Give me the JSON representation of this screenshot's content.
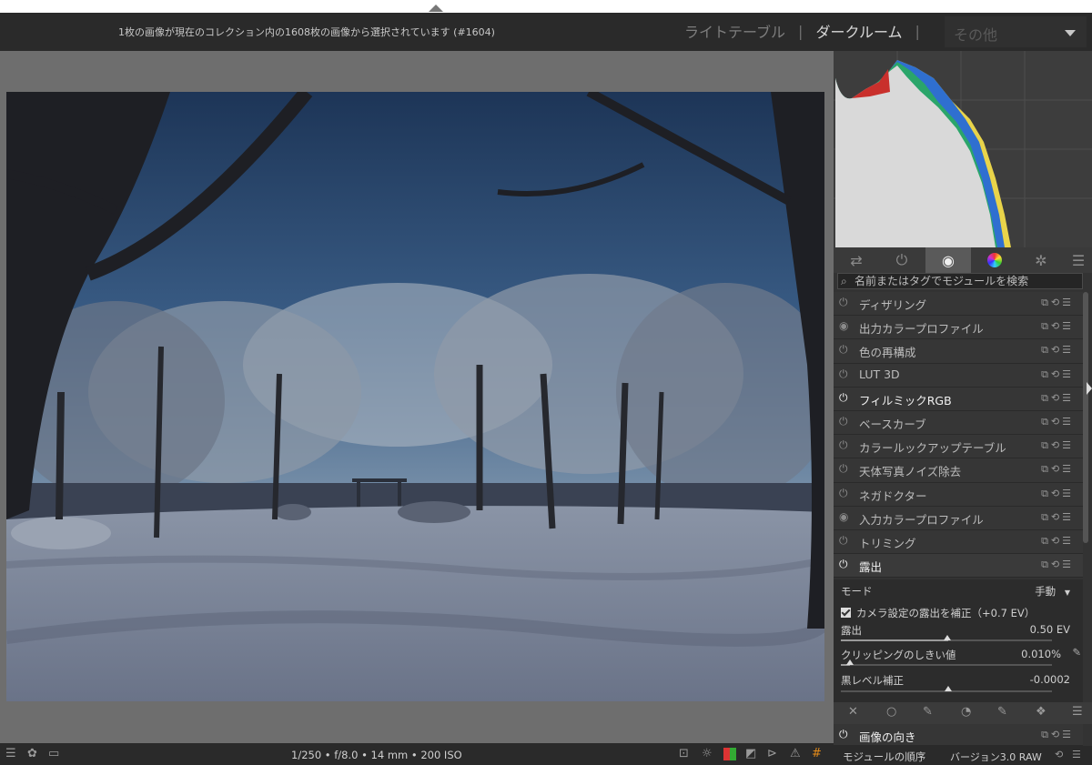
{
  "header": {
    "status": "1枚の画像が現在のコレクション内の1608枚の画像から選択されています (#1604)",
    "views": [
      "ライトテーブル",
      "ダークルーム"
    ],
    "separator": "|",
    "more_label": "その他"
  },
  "panel": {
    "search_placeholder": "名前またはタグでモジュールを検索",
    "modules": [
      {
        "label": "ディザリング",
        "state": "off"
      },
      {
        "label": "出力カラープロファイル",
        "state": "always"
      },
      {
        "label": "色の再構成",
        "state": "off"
      },
      {
        "label": "LUT 3D",
        "state": "off"
      },
      {
        "label": "フィルミックRGB",
        "state": "on"
      },
      {
        "label": "ベースカーブ",
        "state": "off"
      },
      {
        "label": "カラールックアップテーブル",
        "state": "off"
      },
      {
        "label": "天体写真ノイズ除去",
        "state": "off"
      },
      {
        "label": "ネガドクター",
        "state": "off"
      },
      {
        "label": "入力カラープロファイル",
        "state": "always"
      },
      {
        "label": "トリミング",
        "state": "off"
      },
      {
        "label": "露出",
        "state": "on"
      }
    ],
    "exposure": {
      "mode_label": "モード",
      "mode_value": "手動",
      "compensate_label": "カメラ設定の露出を補正（+0.7 EV）",
      "exposure_label": "露出",
      "exposure_value": "0.50 EV",
      "clipping_label": "クリッピングのしきい値",
      "clipping_value": "0.010%",
      "black_label": "黒レベル補正",
      "black_value": "-0.0002"
    },
    "orientation_label": "画像の向き",
    "module_order_label": "モジュールの順序",
    "module_order_value": "バージョン3.0 RAW"
  },
  "bottom": {
    "exif": "1/250 • f/8.0 • 14 mm • 200 ISO"
  },
  "icons": {
    "power": "⏻",
    "copy": "⧉",
    "reset": "⟲",
    "menu": "☰",
    "search": "⌕"
  }
}
